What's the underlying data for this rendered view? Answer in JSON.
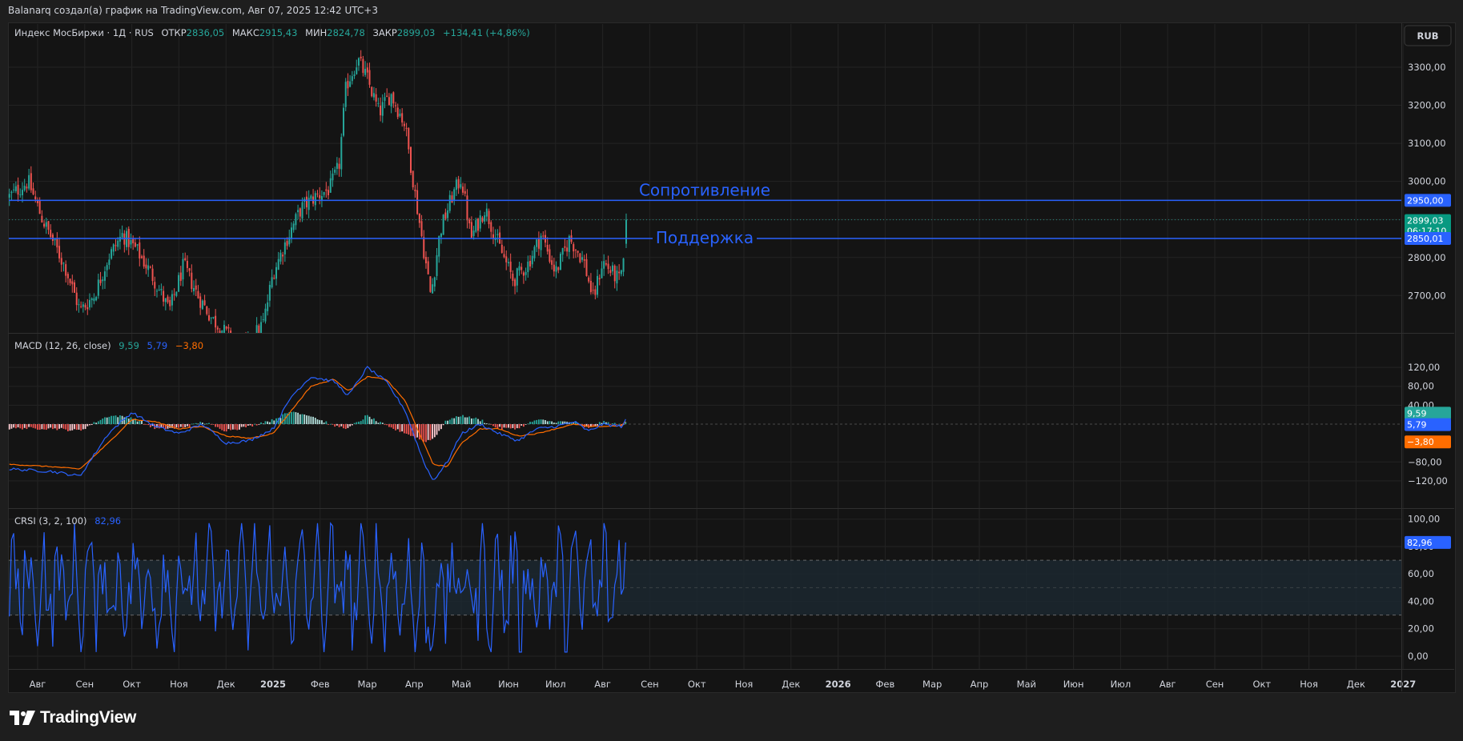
{
  "header": {
    "text": "Balanarq создал(а) график на TradingView.com, Авг 07, 2025 12:42 UTC+3"
  },
  "currency_button": "RUB",
  "main_legend": {
    "symbol": "Индекс МосБиржи · 1Д · RUS",
    "open_label": "ОТКР",
    "open_value": "2836,05",
    "high_label": "МАКС",
    "high_value": "2915,43",
    "low_label": "МИН",
    "low_value": "2824,78",
    "close_label": "ЗАКР",
    "close_value": "2899,03",
    "change": "+134,41 (+4,86%)"
  },
  "macd_legend": {
    "title": "MACD (12, 26, close)",
    "v1": "9,59",
    "v2": "5,79",
    "v3": "−3,80"
  },
  "crsi_legend": {
    "title": "CRSI (3, 2, 100)",
    "v1": "82,96"
  },
  "price_badges": {
    "resistance": "2950,00",
    "last": "2899,03",
    "countdown": "06:17:10",
    "support": "2850,01"
  },
  "macd_badges": {
    "macd": "9,59",
    "signal": "5,79",
    "hist": "−3,80"
  },
  "crsi_badge": "82,96",
  "brand": "TradingView",
  "colors": {
    "up": "#26a69a",
    "down": "#ef5350",
    "line": "#2962ff",
    "macd_line": "#2962ff",
    "signal_line": "#ff6d00",
    "crsi_line": "#2962ff",
    "band": "#1c2a33"
  },
  "chart_data": [
    {
      "type": "candlestick",
      "pane": "price",
      "ylim": [
        2620,
        3380
      ],
      "y_ticks": [
        "3300,00",
        "3200,00",
        "3100,00",
        "3000,00",
        "2900,00",
        "2800,00",
        "2700,00"
      ],
      "y_tick_values": [
        3300,
        3200,
        3100,
        3000,
        2900,
        2800,
        2700
      ],
      "x_ticks": [
        "Авг",
        "Сен",
        "Окт",
        "Ноя",
        "Дек",
        "2025",
        "Фев",
        "Мар",
        "Апр",
        "Май",
        "Июн",
        "Июл",
        "Авг",
        "Сен",
        "Окт",
        "Ноя",
        "Дек",
        "2026",
        "Фев",
        "Мар",
        "Апр",
        "Май",
        "Июн",
        "Июл",
        "Авг",
        "Сен",
        "Окт",
        "Ноя",
        "Дек",
        "2027"
      ],
      "x_tick_months": [
        0,
        1,
        2,
        3,
        4,
        5,
        6,
        7,
        8,
        9,
        10,
        11,
        12,
        13,
        14,
        15,
        16,
        17,
        18,
        19,
        20,
        21,
        22,
        23,
        24,
        25,
        26,
        27,
        28,
        29
      ],
      "close_anchors": [
        {
          "month": -0.6,
          "close": 2960
        },
        {
          "month": -0.2,
          "close": 3000
        },
        {
          "month": 0.1,
          "close": 2900
        },
        {
          "month": 0.3,
          "close": 2850
        },
        {
          "month": 0.6,
          "close": 2770
        },
        {
          "month": 0.9,
          "close": 2660
        },
        {
          "month": 1.2,
          "close": 2700
        },
        {
          "month": 1.5,
          "close": 2800
        },
        {
          "month": 1.8,
          "close": 2860
        },
        {
          "month": 2.1,
          "close": 2820
        },
        {
          "month": 2.4,
          "close": 2760
        },
        {
          "month": 2.8,
          "close": 2660
        },
        {
          "month": 3.1,
          "close": 2780
        },
        {
          "month": 3.4,
          "close": 2700
        },
        {
          "month": 3.7,
          "close": 2640
        },
        {
          "month": 4.0,
          "close": 2600
        },
        {
          "month": 4.4,
          "close": 2560
        },
        {
          "month": 4.8,
          "close": 2630
        },
        {
          "month": 5.0,
          "close": 2760
        },
        {
          "month": 5.3,
          "close": 2850
        },
        {
          "month": 5.6,
          "close": 2930
        },
        {
          "month": 5.9,
          "close": 2960
        },
        {
          "month": 6.2,
          "close": 2980
        },
        {
          "month": 6.4,
          "close": 3040
        },
        {
          "month": 6.55,
          "close": 3250
        },
        {
          "month": 6.8,
          "close": 3320
        },
        {
          "month": 7.0,
          "close": 3270
        },
        {
          "month": 7.25,
          "close": 3180
        },
        {
          "month": 7.5,
          "close": 3230
        },
        {
          "month": 7.8,
          "close": 3150
        },
        {
          "month": 8.0,
          "close": 2980
        },
        {
          "month": 8.2,
          "close": 2820
        },
        {
          "month": 8.35,
          "close": 2700
        },
        {
          "month": 8.55,
          "close": 2870
        },
        {
          "month": 8.8,
          "close": 2960
        },
        {
          "month": 9.0,
          "close": 3010
        },
        {
          "month": 9.2,
          "close": 2850
        },
        {
          "month": 9.5,
          "close": 2930
        },
        {
          "month": 9.8,
          "close": 2830
        },
        {
          "month": 10.1,
          "close": 2740
        },
        {
          "month": 10.4,
          "close": 2780
        },
        {
          "month": 10.7,
          "close": 2860
        },
        {
          "month": 11.0,
          "close": 2760
        },
        {
          "month": 11.3,
          "close": 2850
        },
        {
          "month": 11.6,
          "close": 2790
        },
        {
          "month": 11.8,
          "close": 2690
        },
        {
          "month": 12.0,
          "close": 2790
        },
        {
          "month": 12.2,
          "close": 2760
        },
        {
          "month": 12.35,
          "close": 2740
        },
        {
          "month": 12.45,
          "close": 2780
        },
        {
          "month": 12.5,
          "close": 2899.03
        }
      ],
      "last_candle": {
        "open": 2836.05,
        "high": 2915.43,
        "low": 2824.78,
        "close": 2899.03
      },
      "annotations": [
        {
          "label": "Сопротивление",
          "price": 2950.0
        },
        {
          "label": "Поддержка",
          "price": 2850.01
        }
      ]
    },
    {
      "type": "line",
      "pane": "macd",
      "series": [
        {
          "name": "MACD",
          "values_anchor": [
            [
              -0.6,
              -95
            ],
            [
              0.3,
              -100
            ],
            [
              0.9,
              -110
            ],
            [
              1.5,
              -20
            ],
            [
              2.0,
              25
            ],
            [
              2.5,
              -5
            ],
            [
              3.0,
              -20
            ],
            [
              3.5,
              0
            ],
            [
              4.0,
              -40
            ],
            [
              4.5,
              -35
            ],
            [
              5.0,
              -10
            ],
            [
              5.4,
              60
            ],
            [
              5.8,
              100
            ],
            [
              6.3,
              90
            ],
            [
              6.6,
              60
            ],
            [
              7.0,
              120
            ],
            [
              7.4,
              90
            ],
            [
              7.8,
              30
            ],
            [
              8.2,
              -80
            ],
            [
              8.4,
              -120
            ],
            [
              8.7,
              -80
            ],
            [
              9.0,
              -20
            ],
            [
              9.4,
              0
            ],
            [
              9.8,
              -20
            ],
            [
              10.2,
              -35
            ],
            [
              10.6,
              -10
            ],
            [
              11.0,
              -5
            ],
            [
              11.4,
              5
            ],
            [
              11.7,
              -15
            ],
            [
              12.0,
              0
            ],
            [
              12.4,
              -5
            ],
            [
              12.5,
              9.59
            ]
          ]
        },
        {
          "name": "Signal",
          "values_anchor": [
            [
              -0.6,
              -85
            ],
            [
              0.3,
              -90
            ],
            [
              0.9,
              -95
            ],
            [
              1.5,
              -40
            ],
            [
              2.0,
              10
            ],
            [
              2.5,
              5
            ],
            [
              3.0,
              -10
            ],
            [
              3.5,
              -5
            ],
            [
              4.0,
              -25
            ],
            [
              4.5,
              -30
            ],
            [
              5.0,
              -20
            ],
            [
              5.4,
              30
            ],
            [
              5.8,
              80
            ],
            [
              6.3,
              95
            ],
            [
              6.6,
              70
            ],
            [
              7.0,
              100
            ],
            [
              7.4,
              95
            ],
            [
              7.8,
              50
            ],
            [
              8.2,
              -40
            ],
            [
              8.4,
              -85
            ],
            [
              8.7,
              -90
            ],
            [
              9.0,
              -40
            ],
            [
              9.4,
              -10
            ],
            [
              9.8,
              -10
            ],
            [
              10.2,
              -25
            ],
            [
              10.6,
              -20
            ],
            [
              11.0,
              -10
            ],
            [
              11.4,
              0
            ],
            [
              11.7,
              -5
            ],
            [
              12.0,
              -5
            ],
            [
              12.4,
              -3
            ],
            [
              12.5,
              5.79
            ]
          ]
        }
      ],
      "ylim": [
        -140,
        140
      ],
      "y_ticks": [
        "120,00",
        "80,00",
        "40,00",
        "−80,00",
        "−120,00"
      ],
      "y_tick_values": [
        120,
        80,
        40,
        -80,
        -120
      ]
    },
    {
      "type": "line",
      "pane": "crsi",
      "series": [
        {
          "name": "CRSI",
          "last": 82.96
        }
      ],
      "ylim": [
        -5,
        100
      ],
      "y_ticks": [
        "100,00",
        "80,00",
        "60,00",
        "40,00",
        "20,00",
        "0,00"
      ],
      "y_tick_values": [
        100,
        80,
        60,
        40,
        20,
        0
      ],
      "band": [
        30,
        70
      ]
    }
  ]
}
